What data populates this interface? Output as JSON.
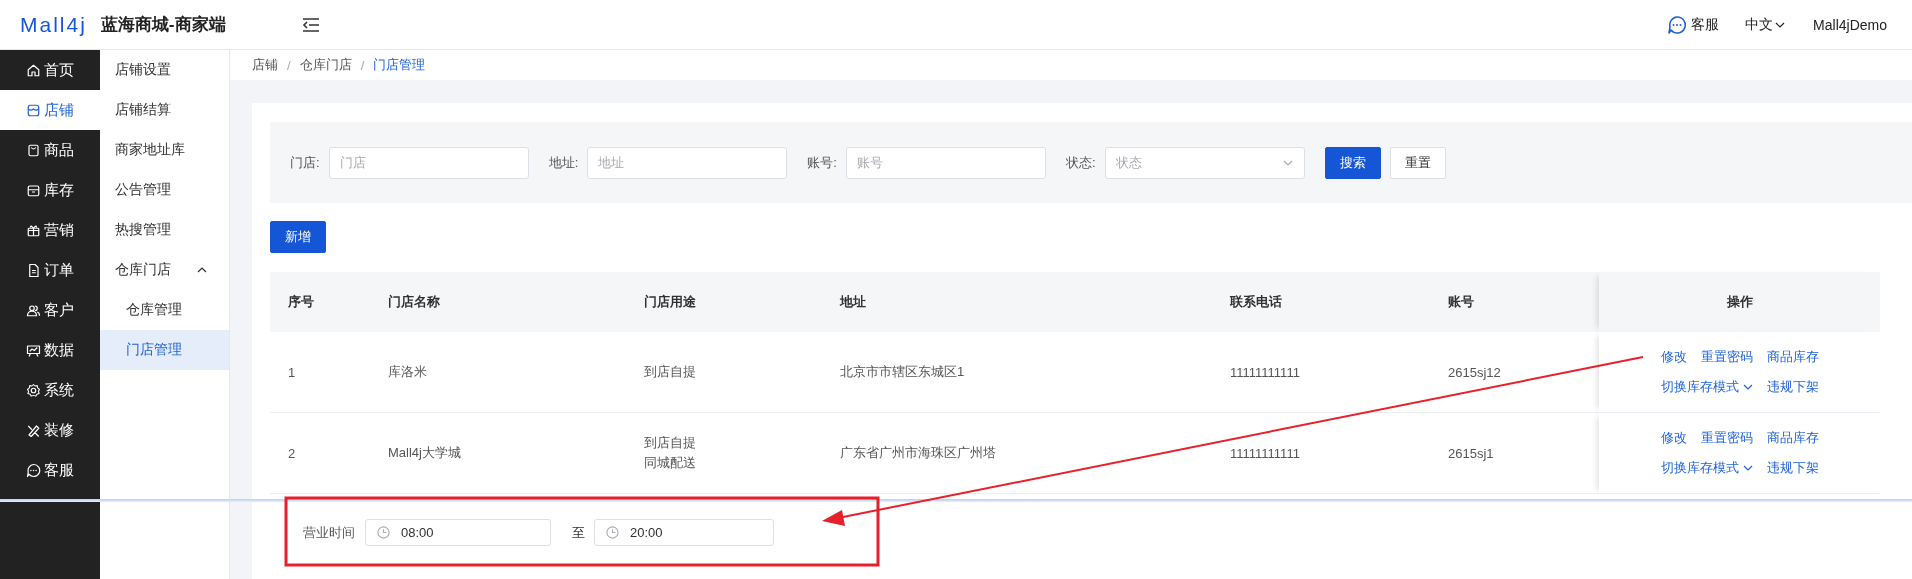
{
  "header": {
    "logo": "Mall4j",
    "title": "蓝海商城-商家端",
    "support": "客服",
    "language": "中文",
    "user": "Mall4jDemo"
  },
  "nav": [
    {
      "label": "首页",
      "selected": false
    },
    {
      "label": "店铺",
      "selected": true
    },
    {
      "label": "商品",
      "selected": false
    },
    {
      "label": "库存",
      "selected": false
    },
    {
      "label": "营销",
      "selected": false
    },
    {
      "label": "订单",
      "selected": false
    },
    {
      "label": "客户",
      "selected": false
    },
    {
      "label": "数据",
      "selected": false
    },
    {
      "label": "系统",
      "selected": false
    },
    {
      "label": "装修",
      "selected": false
    },
    {
      "label": "客服",
      "selected": false
    }
  ],
  "submenu": [
    {
      "label": "店铺设置",
      "selected": false
    },
    {
      "label": "店铺结算",
      "selected": false
    },
    {
      "label": "商家地址库",
      "selected": false
    },
    {
      "label": "公告管理",
      "selected": false
    },
    {
      "label": "热搜管理",
      "selected": false
    },
    {
      "label": "仓库门店",
      "expanded": true,
      "children": [
        {
          "label": "仓库管理",
          "selected": false
        },
        {
          "label": "门店管理",
          "selected": true
        }
      ]
    }
  ],
  "breadcrumb": {
    "items": [
      {
        "label": "店铺",
        "current": false
      },
      {
        "label": "仓库门店",
        "current": false
      },
      {
        "label": "门店管理",
        "current": true
      }
    ],
    "separators": [
      "/",
      "/"
    ]
  },
  "filters": [
    {
      "kind": "input",
      "label": "门店:",
      "placeholder": "门店"
    },
    {
      "kind": "input",
      "label": "地址:",
      "placeholder": "地址"
    },
    {
      "kind": "input",
      "label": "账号:",
      "placeholder": "账号"
    },
    {
      "kind": "select",
      "label": "状态:",
      "placeholder": "状态"
    }
  ],
  "search_button": "搜索",
  "reset_button": "重置",
  "add_button": "新增",
  "table": {
    "columns": [
      "序号",
      "门店名称",
      "门店用途",
      "地址",
      "联系电话",
      "账号",
      "操作"
    ],
    "rows": [
      {
        "index": "1",
        "name": "库洛米",
        "usage": [
          "到店自提"
        ],
        "address": "北京市市辖区东城区1",
        "phone": "11111111111",
        "account": "2615sj12",
        "action_rows": [
          [
            {
              "label": "修改",
              "dropdown": false
            },
            {
              "label": "重置密码",
              "dropdown": false
            },
            {
              "label": "商品库存",
              "dropdown": false
            }
          ],
          [
            {
              "label": "切换库存模式",
              "dropdown": true
            },
            {
              "label": "违规下架",
              "dropdown": false
            }
          ]
        ]
      },
      {
        "index": "2",
        "name": "Mall4j大学城",
        "usage": [
          "到店自提",
          "同城配送"
        ],
        "address": "广东省广州市海珠区广州塔",
        "phone": "11111111111",
        "account": "2615sj1",
        "action_rows": [
          [
            {
              "label": "修改",
              "dropdown": false
            },
            {
              "label": "重置密码",
              "dropdown": false
            },
            {
              "label": "商品库存",
              "dropdown": false
            }
          ],
          [
            {
              "label": "切换库存模式",
              "dropdown": true
            },
            {
              "label": "违规下架",
              "dropdown": false
            }
          ]
        ]
      }
    ]
  },
  "business_hours": {
    "label": "营业时间",
    "start": "08:00",
    "separator": "至",
    "end": "20:00"
  }
}
